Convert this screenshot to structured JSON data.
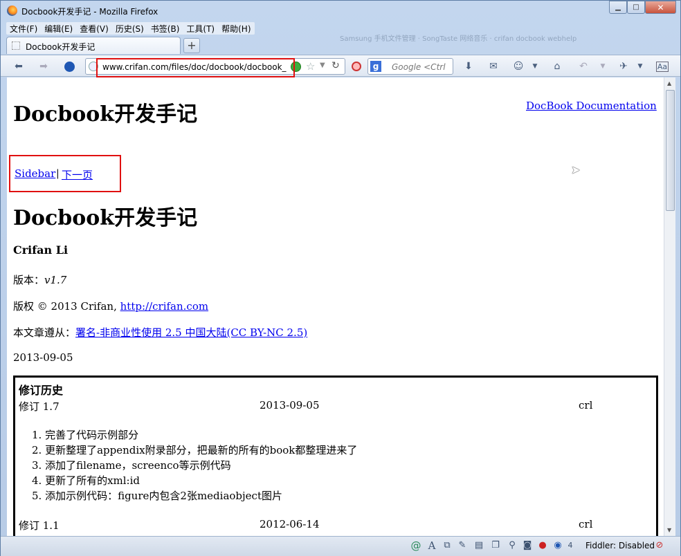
{
  "window": {
    "title": "Docbook开发手记 - Mozilla Firefox",
    "bg_tabs_text": "Samsung 手机文件管理  ·  SongTaste 网络音乐  ·  crifan docbook webhelp"
  },
  "menubar": {
    "items": [
      "文件(F)",
      "编辑(E)",
      "查看(V)",
      "历史(S)",
      "书签(B)",
      "工具(T)",
      "帮助(H)"
    ]
  },
  "tab": {
    "title": "Docbook开发手记",
    "new_tab": "+"
  },
  "url": {
    "value": "www.crifan.com/files/doc/docbook/docbook_dev"
  },
  "search": {
    "engine": "g",
    "placeholder": "Google <Ctrl"
  },
  "page": {
    "title": "Docbook开发手记",
    "doc_link": "DocBook Documentation",
    "nav_sidebar": "Sidebar",
    "nav_sep": "|",
    "nav_next": "下一页",
    "heading": "Docbook开发手记",
    "author": "Crifan Li",
    "version_label": "版本：",
    "version": "v1.7",
    "copyright_text": "版权 © 2013 Crifan,",
    "copyright_link": "http://crifan.com",
    "license_text": "本文章遵从：",
    "license_link": "署名-非商业性使用 2.5 中国大陆(CC BY-NC 2.5)",
    "date": "2013-09-05"
  },
  "revision_history": {
    "title": "修订历史",
    "rows": [
      {
        "rev": "修订 1.7",
        "date": "2013-09-05",
        "author": "crl"
      },
      {
        "rev": "修订 1.1",
        "date": "2012-06-14",
        "author": "crl"
      }
    ],
    "items": [
      "1.  完善了代码示例部分",
      "2.  更新整理了appendix附录部分，把最新的所有的book都整理进来了",
      "3.  添加了filename，screenco等示例代码",
      "4.  更新了所有的xml:id",
      "5.  添加示例代码：figure内包含2张mediaobject图片"
    ]
  },
  "status": {
    "fiddler": "Fiddler: Disabled",
    "count": "4"
  }
}
